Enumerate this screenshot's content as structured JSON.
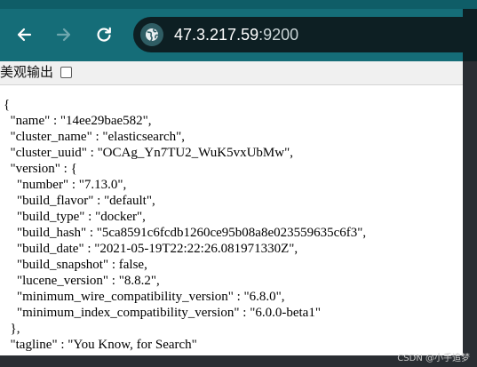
{
  "browser": {
    "address_bar": {
      "host": "47.3.217.59",
      "port": ":9200"
    },
    "buttons": {
      "back_icon": "arrow-left-icon",
      "forward_icon": "arrow-right-icon",
      "reload_icon": "reload-icon",
      "site_icon": "globe-icon"
    },
    "colors": {
      "toolbar": "#156d78",
      "omnibox": "#0d1f23",
      "forward_disabled": "#6fa7ae"
    }
  },
  "page": {
    "pretty_print": {
      "label": "美观输出",
      "checked": false
    },
    "json_lines": [
      "{",
      "  \"name\" : \"14ee29bae582\",",
      "  \"cluster_name\" : \"elasticsearch\",",
      "  \"cluster_uuid\" : \"OCAg_Yn7TU2_WuK5vxUbMw\",",
      "  \"version\" : {",
      "    \"number\" : \"7.13.0\",",
      "    \"build_flavor\" : \"default\",",
      "    \"build_type\" : \"docker\",",
      "    \"build_hash\" : \"5ca8591c6fcdb1260ce95b08a8e023559635c6f3\",",
      "    \"build_date\" : \"2021-05-19T22:22:26.081971330Z\",",
      "    \"build_snapshot\" : false,",
      "    \"lucene_version\" : \"8.8.2\",",
      "    \"minimum_wire_compatibility_version\" : \"6.8.0\",",
      "    \"minimum_index_compatibility_version\" : \"6.0.0-beta1\"",
      "  },",
      "  \"tagline\" : \"You Know, for Search\""
    ]
  },
  "watermark": "CSDN @小手追梦"
}
